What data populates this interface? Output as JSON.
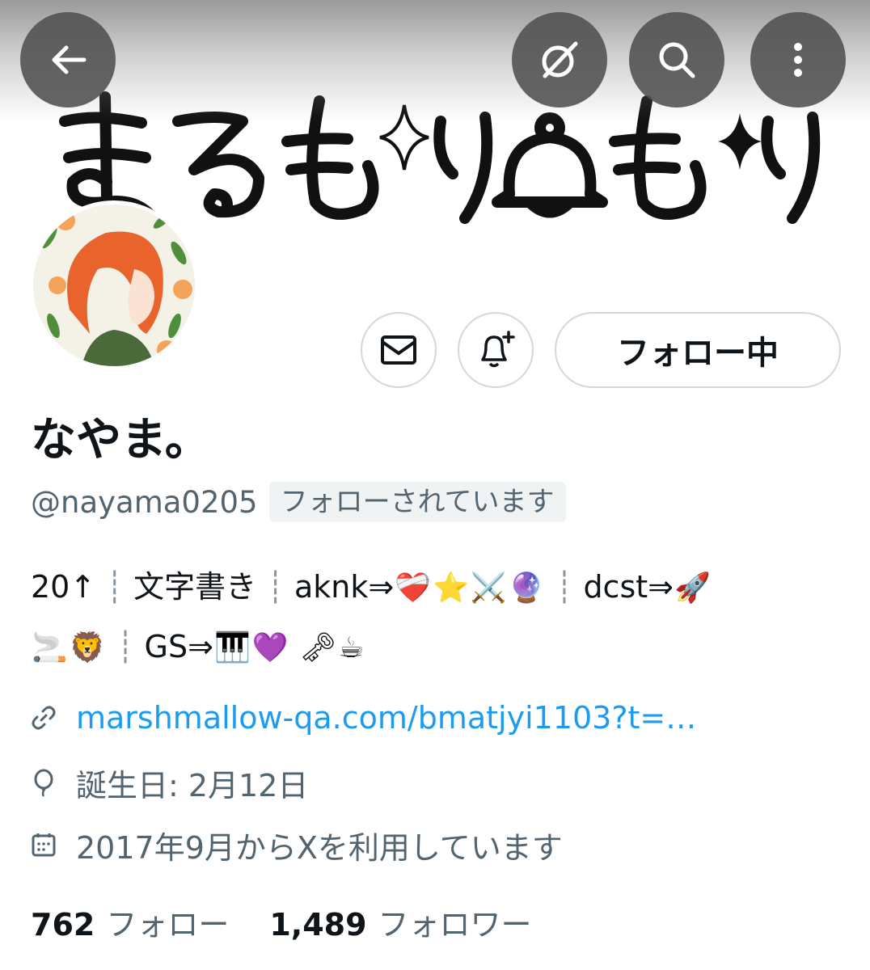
{
  "banner": {
    "title_art": "まるもり🔔もり"
  },
  "top_bar": {
    "back_icon": "arrow-left-icon",
    "grok_icon": "grok-icon",
    "search_icon": "search-icon",
    "more_icon": "more-vertical-icon"
  },
  "actions": {
    "message_icon": "envelope-icon",
    "notify_icon": "bell-plus-icon",
    "follow_label": "フォロー中"
  },
  "profile": {
    "display_name": "なやま。",
    "handle": "@nayama0205",
    "follows_you": "フォローされています"
  },
  "bio": {
    "line1": {
      "p1": "20↑",
      "sep": "┊",
      "p2": "文字書き",
      "p3": "aknk⇒",
      "e1": "❤️‍🩹",
      "e2": "⭐",
      "e3": "⚔️",
      "e4": "🔮",
      "p4": "dcst⇒",
      "e5": "🚀"
    },
    "line2": {
      "e1": "🚬",
      "e2": "🦁",
      "sep": "┊",
      "p1": "GS⇒",
      "e3": "🎹",
      "e4": "💜",
      "e5": "🗝",
      "e6": "☕"
    }
  },
  "meta": {
    "link": "marshmallow-qa.com/bmatjyi1103?t=…",
    "birthday": "誕生日: 2月12日",
    "joined": "2017年9月からXを利用しています"
  },
  "stats": {
    "following_count": "762",
    "following_label": "フォロー",
    "followers_count": "1,489",
    "followers_label": "フォロワー"
  },
  "colors": {
    "link": "#1d9bf0",
    "secondary_text": "#536471",
    "primary_text": "#0f1419",
    "border": "#cfd9de"
  }
}
